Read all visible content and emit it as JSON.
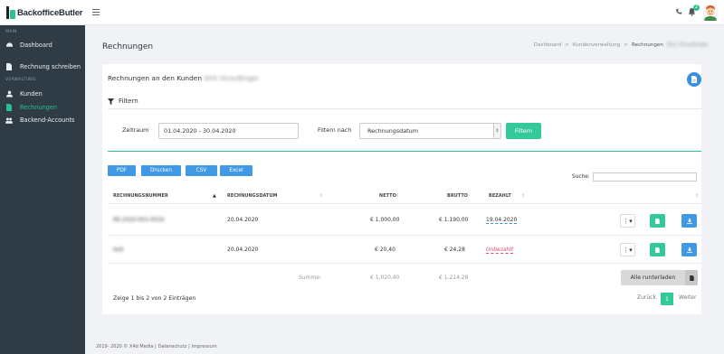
{
  "brand": {
    "name": "BackofficeButler"
  },
  "topbar": {
    "notification_count": "2"
  },
  "sidebar": {
    "section_main": "MAIN",
    "section_admin": "VERWALTUNG",
    "items": [
      {
        "label": "Dashboard",
        "icon": "dashboard-icon"
      },
      {
        "label": "Rechnung schreiben",
        "icon": "document-icon"
      },
      {
        "label": "Kunden",
        "icon": "user-icon"
      },
      {
        "label": "Rechnungen",
        "icon": "invoice-icon",
        "active": true
      },
      {
        "label": "Backend-Accounts",
        "icon": "users-icon"
      }
    ]
  },
  "page": {
    "title": "Rechnungen",
    "breadcrumb": [
      "Dashboard",
      "Kundenverwaltung",
      "Rechnungen"
    ],
    "breadcrumb_customer": "Dirk Straußinger"
  },
  "card": {
    "title": "Rechnungen an den Kunden",
    "customer_name": "Dirk Straußinger",
    "filter_heading": "Filtern",
    "zeitraum_label": "Zeitraum",
    "zeitraum_value": "01.04.2020 - 30.04.2020",
    "filter_by_label": "Filtern nach",
    "filter_by_value": "Rechnungsdatum",
    "filter_button": "Filtern",
    "export_buttons": [
      "PDF",
      "Drucken",
      "CSV",
      "Excel"
    ],
    "search_label": "Suche:",
    "search_value": ""
  },
  "table": {
    "headers": {
      "number": "RECHNUNGSNUMMER",
      "date": "RECHNUNGSDATUM",
      "net": "NETTO",
      "gross": "BRUTTO",
      "paid": "BEZAHLT"
    },
    "rows": [
      {
        "number": "RE-2020-001-0016",
        "date": "20.04.2020",
        "net": "€ 1.000,00",
        "gross": "€ 1.190,00",
        "paid": "19.04.2020",
        "status": "paid"
      },
      {
        "number": "test",
        "date": "20.04.2020",
        "net": "€ 20,40",
        "gross": "€ 24,28",
        "paid": "Unbezahlt",
        "status": "unpaid"
      }
    ],
    "sum_label": "Summe:",
    "sum_net": "€ 1.020,40",
    "sum_gross": "€ 1.214,28",
    "download_all": "Alle runterladen",
    "info": "Zeige 1 bis 2 von 2 Einträgen",
    "pagination": {
      "prev": "Zurück",
      "current": "1",
      "next": "Weiter"
    }
  },
  "footer": {
    "copyright": "2019- 2020 © X4d Media |",
    "privacy": "Datenschutz",
    "sep": "|",
    "imprint": "Impressum"
  },
  "colors": {
    "accent": "#28c18f",
    "primary": "#4199e6",
    "sidebar": "#2f3b45",
    "unpaid": "#e04a6f"
  }
}
